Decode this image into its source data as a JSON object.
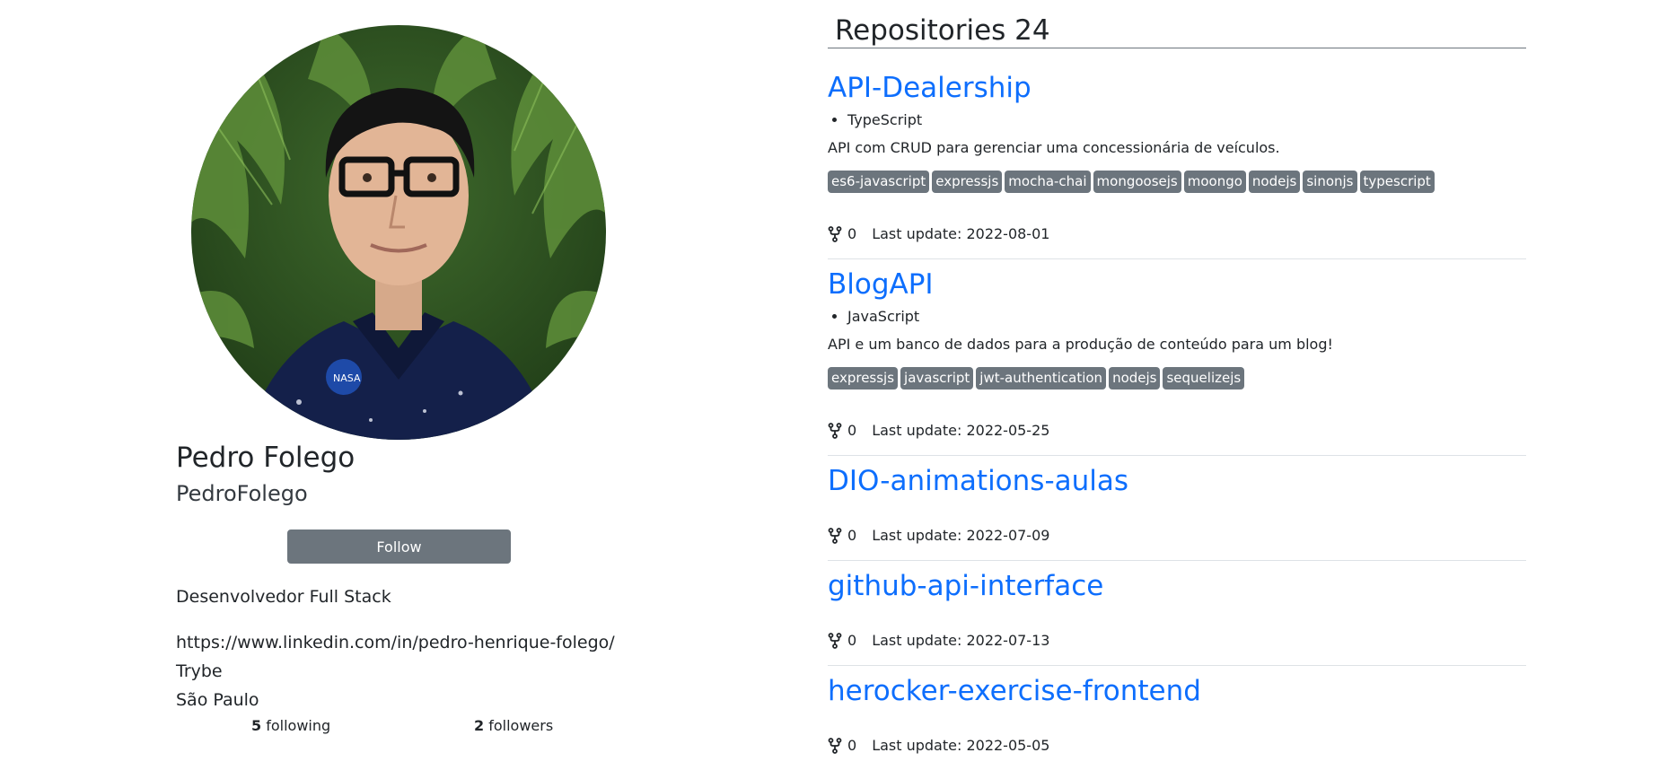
{
  "profile": {
    "name": "Pedro Folego",
    "login": "PedroFolego",
    "follow_label": "Follow",
    "bio": "Desenvolvedor Full Stack",
    "blog": "https://www.linkedin.com/in/pedro-henrique-folego/",
    "company": "Trybe",
    "location": "São Paulo",
    "following_count": "5",
    "following_label": "following",
    "followers_count": "2",
    "followers_label": "followers"
  },
  "repositories": {
    "title": "Repositories 24",
    "fork_icon": "repo-forked-icon",
    "items": [
      {
        "name": "API-Dealership",
        "language": "TypeScript",
        "description": "API com CRUD para gerenciar uma concessionária de veículos.",
        "topics": [
          "es6-javascript",
          "expressjs",
          "mocha-chai",
          "mongoosejs",
          "moongo",
          "nodejs",
          "sinonjs",
          "typescript"
        ],
        "forks": "0",
        "last_update": "Last update: 2022-08-01"
      },
      {
        "name": "BlogAPI",
        "language": "JavaScript",
        "description": "API e um banco de dados para a produção de conteúdo para um blog!",
        "topics": [
          "expressjs",
          "javascript",
          "jwt-authentication",
          "nodejs",
          "sequelizejs"
        ],
        "forks": "0",
        "last_update": "Last update: 2022-05-25"
      },
      {
        "name": "DIO-animations-aulas",
        "forks": "0",
        "last_update": "Last update: 2022-07-09"
      },
      {
        "name": "github-api-interface",
        "forks": "0",
        "last_update": "Last update: 2022-07-13"
      },
      {
        "name": "herocker-exercise-frontend",
        "forks": "0",
        "last_update": "Last update: 2022-05-05"
      }
    ]
  },
  "colors": {
    "link": "#0d6efd",
    "badge": "#6c757d",
    "text": "#212529"
  }
}
